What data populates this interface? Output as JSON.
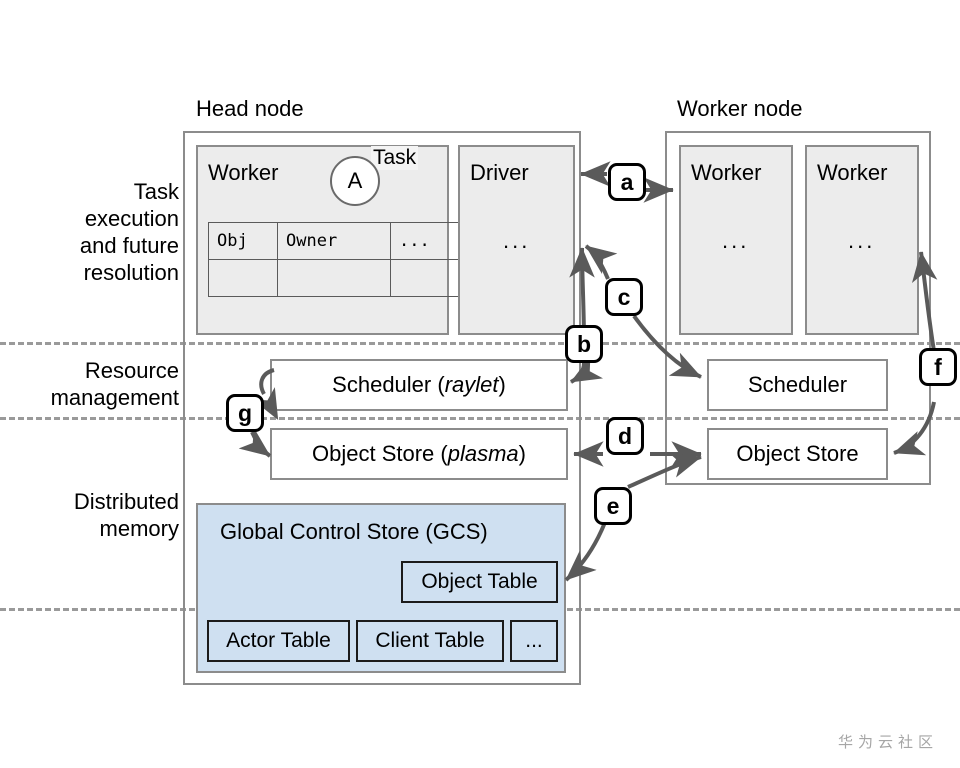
{
  "figure": {
    "watermark": "华为云社区"
  },
  "row_labels": [
    {
      "id": "task-execution",
      "text": "Task\nexecution\nand future\nresolution"
    },
    {
      "id": "resource-management",
      "text": "Resource\nmanagement"
    },
    {
      "id": "distributed-memory",
      "text": "Distributed\nmemory"
    }
  ],
  "head_node": {
    "title": "Head node",
    "worker": {
      "title": "Worker",
      "task_circle_label": "A",
      "task_tag": "Task",
      "ownership_table": {
        "headers": [
          "Obj",
          "Owner",
          "..."
        ],
        "rows": [
          [
            "",
            "",
            ""
          ]
        ]
      }
    },
    "driver": {
      "title": "Driver",
      "dots": "..."
    },
    "scheduler": {
      "label_prefix": "Scheduler (",
      "label_emph": "raylet",
      "label_suffix": ")"
    },
    "object_store": {
      "label_prefix": "Object Store (",
      "label_emph": "plasma",
      "label_suffix": ")"
    },
    "gcs": {
      "title": "Global Control Store (GCS)",
      "tiles": [
        {
          "id": "object-table",
          "label": "Object Table"
        },
        {
          "id": "actor-table",
          "label": "Actor Table"
        },
        {
          "id": "client-table",
          "label": "Client Table"
        },
        {
          "id": "more-tables",
          "label": "..."
        }
      ]
    }
  },
  "worker_node": {
    "title": "Worker node",
    "workers": [
      {
        "title": "Worker",
        "dots": "..."
      },
      {
        "title": "Worker",
        "dots": "..."
      }
    ],
    "scheduler": {
      "label": "Scheduler"
    },
    "object_store": {
      "label": "Object Store"
    }
  },
  "edge_badges": [
    {
      "id": "a",
      "label": "a"
    },
    {
      "id": "b",
      "label": "b"
    },
    {
      "id": "c",
      "label": "c"
    },
    {
      "id": "d",
      "label": "d"
    },
    {
      "id": "e",
      "label": "e"
    },
    {
      "id": "f",
      "label": "f"
    },
    {
      "id": "g",
      "label": "g"
    }
  ],
  "colors": {
    "gcs_fill": "#cfe0f1",
    "process_fill": "#ececec",
    "outline": "#8c8c8c",
    "arrow": "#5a5a5a",
    "separator": "#9a9a9a",
    "watermark": "#a6a6a6"
  }
}
